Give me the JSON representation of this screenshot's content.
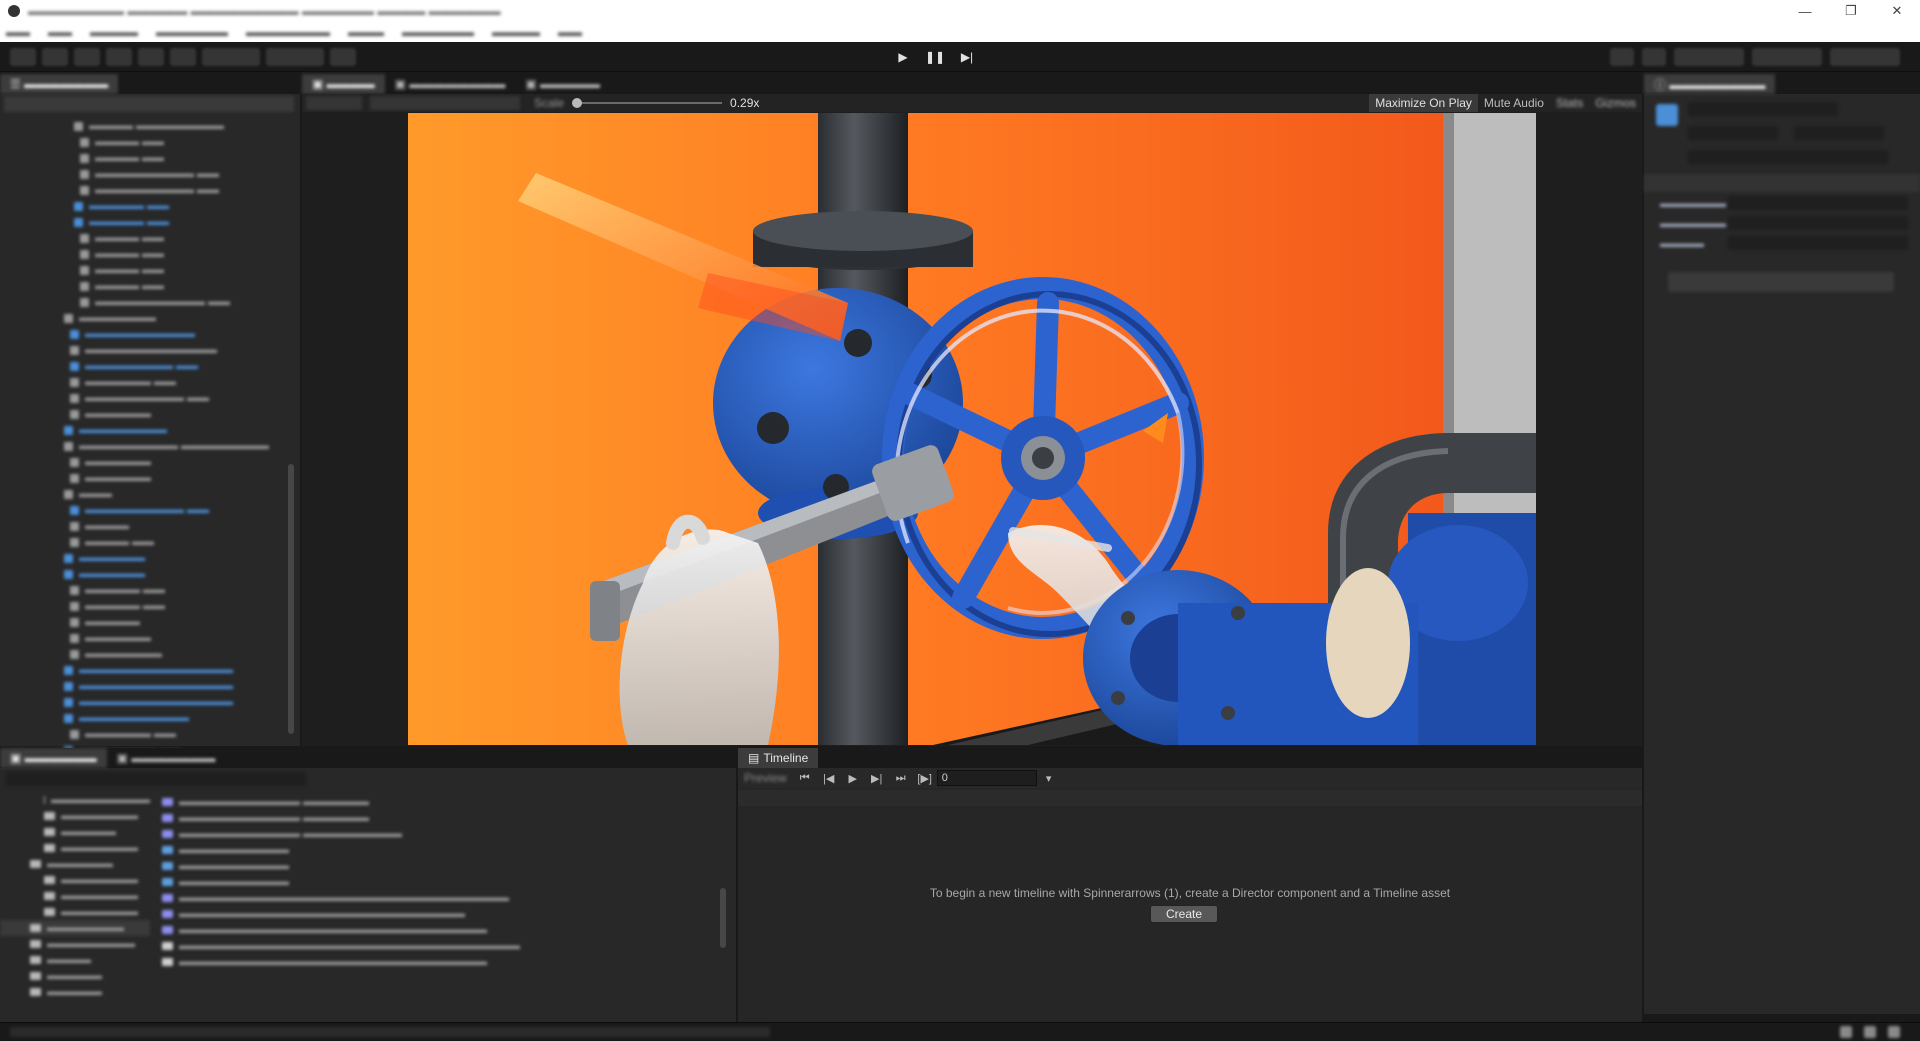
{
  "toolbar": {
    "play": "▶",
    "pause": "❚❚",
    "step": "▶|"
  },
  "game_view": {
    "scale_label": "Scale",
    "scale_value": "0.29x",
    "maximize_on_play": "Maximize On Play",
    "mute_audio": "Mute Audio",
    "stats": "Stats",
    "gizmos": "Gizmos"
  },
  "timeline": {
    "tab_label": "Timeline",
    "preview_label": "Preview",
    "frame_value": "0",
    "message": "To begin a new timeline with Spinnerarrows (1), create a Director component and a Timeline asset",
    "create_label": "Create"
  },
  "colors": {
    "accent_blue": "#4a8fd8",
    "panel_bg": "#282828",
    "toolbar_bg": "#191919",
    "orange_wall": "#f26a1e",
    "valve_blue": "#2a5fc4"
  },
  "icons": {
    "play": "play-icon",
    "pause": "pause-icon",
    "step": "step-icon",
    "timeline": "timeline-icon"
  }
}
